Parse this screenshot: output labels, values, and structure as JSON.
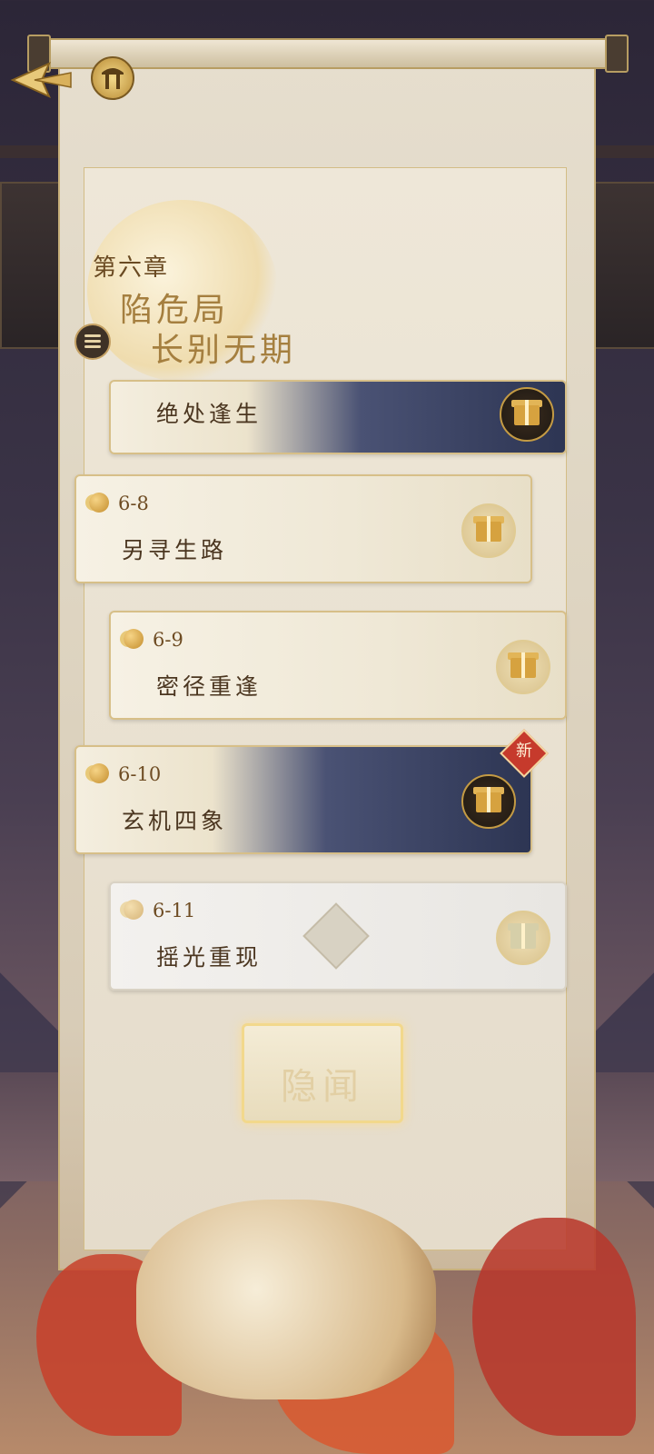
{
  "header": {
    "back_icon": "back-arrow-icon",
    "logo_icon": "pavilion-emblem-icon"
  },
  "chapter": {
    "label": "第六章",
    "title_line1": "陷危局",
    "title_line2": "长别无期",
    "menu_icon": "menu-icon"
  },
  "stages": [
    {
      "number": "",
      "name": "绝处逢生",
      "state": "cleared-art",
      "reward_icon": "gift-icon"
    },
    {
      "number": "6-8",
      "name": "另寻生路",
      "state": "cleared",
      "reward_icon": "gift-icon"
    },
    {
      "number": "6-9",
      "name": "密径重逢",
      "state": "cleared",
      "reward_icon": "gift-icon"
    },
    {
      "number": "6-10",
      "name": "玄机四象",
      "state": "current",
      "reward_icon": "gift-icon",
      "badge": "新"
    },
    {
      "number": "6-11",
      "name": "摇光重现",
      "state": "locked",
      "reward_icon": "gift-icon",
      "lock_icon": "lock-icon"
    }
  ],
  "secret_button": {
    "label": "隐闻"
  },
  "colors": {
    "accent_gold": "#c49b44",
    "new_badge": "#c63a2c",
    "text_dark": "#4b3620"
  }
}
